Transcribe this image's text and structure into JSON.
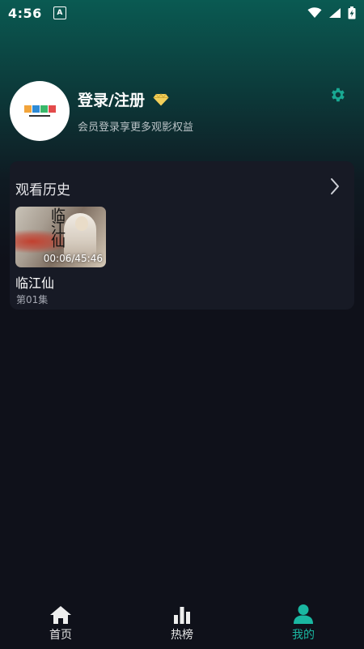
{
  "status_bar": {
    "time": "4:56",
    "badge": "A",
    "icons": [
      "wifi-icon",
      "cellular-icon",
      "battery-charging-icon"
    ]
  },
  "profile": {
    "login_label": "登录/注册",
    "subtitle": "会员登录享更多观影权益",
    "vip_icon": "diamond-icon",
    "settings_icon": "gear-icon",
    "avatar_logo_colors": [
      "#f2a43a",
      "#2e8bd6",
      "#39b86a",
      "#e34b4b"
    ]
  },
  "history": {
    "title": "观看历史",
    "more_icon": "chevron-right-icon",
    "items": [
      {
        "title": "临江仙",
        "episode": "第01集",
        "progress": "00:06/45:46",
        "poster_text": "临江仙"
      }
    ]
  },
  "nav": {
    "items": [
      {
        "label": "首页",
        "icon": "home-icon",
        "active": false
      },
      {
        "label": "热榜",
        "icon": "bar-chart-icon",
        "active": false
      },
      {
        "label": "我的",
        "icon": "user-icon",
        "active": true
      }
    ]
  },
  "colors": {
    "accent": "#1ab7a1",
    "background": "#0f111a",
    "card": "#171a25",
    "diamond": "#f3d05a"
  }
}
